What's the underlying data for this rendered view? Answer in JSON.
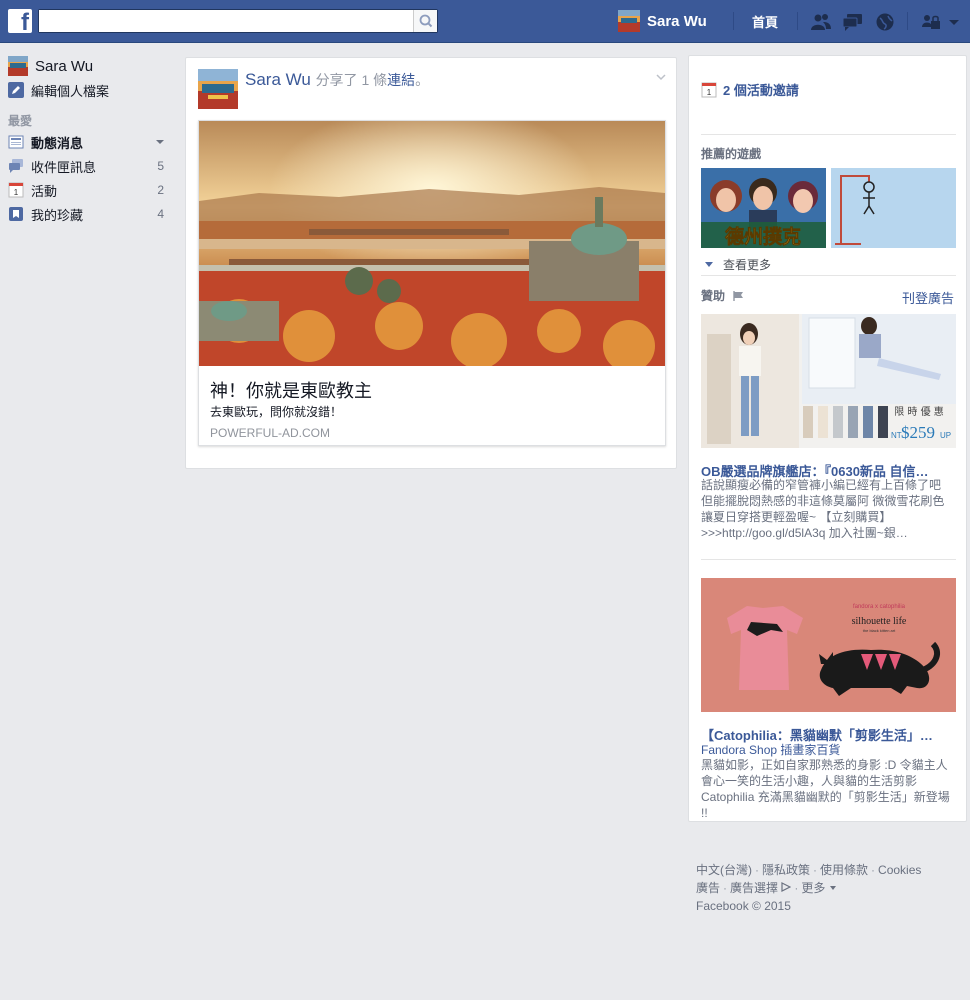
{
  "colors": {
    "brand": "#3b5998",
    "link": "#3b5998",
    "muted": "#9197a3"
  },
  "topbar": {
    "logo": "f",
    "search": {
      "value": "",
      "placeholder": "",
      "icon": "search-icon"
    },
    "profile_name": "Sara Wu",
    "home_label": "首頁",
    "icons": [
      "friend-requests-icon",
      "messages-icon",
      "notifications-globe-icon",
      "privacy-shortcuts-icon",
      "account-menu-chevron-icon"
    ]
  },
  "leftnav": {
    "profile_name": "Sara Wu",
    "edit_profile": "編輯個人檔案",
    "favorites_heading": "最愛",
    "items": [
      {
        "label": "動態消息",
        "icon": "news-feed-icon",
        "count": "",
        "bold": true
      },
      {
        "label": "收件匣訊息",
        "icon": "messages-icon",
        "count": "5"
      },
      {
        "label": "活動",
        "icon": "calendar-icon",
        "count": "2"
      },
      {
        "label": "我的珍藏",
        "icon": "saved-bookmark-icon",
        "count": "4"
      }
    ]
  },
  "post": {
    "author": "Sara Wu",
    "action_prefix": "分享了 1 條",
    "action_link": "連結",
    "action_suffix": "。",
    "card": {
      "title": "神！你就是東歐教主",
      "description": "去東歐玩，問你就沒錯！",
      "domain": "POWERFUL-AD.COM"
    }
  },
  "rightcol": {
    "events": "2 個活動邀請",
    "games_heading": "推薦的遊戲",
    "games": [
      {
        "title": "德州撲克"
      },
      {
        "title": ""
      }
    ],
    "see_more": "查看更多",
    "sponsored_heading": "贊助",
    "create_ad": "刊登廣告",
    "ads": [
      {
        "image_text_1": "限 時 優 惠",
        "image_price_prefix": "NT",
        "image_price": "$259",
        "image_price_suffix": "UP",
        "title": "OB嚴選品牌旗艦店：『0630新品 自信…",
        "body": "話說顯瘦必備的窄管褲小編已經有上百條了吧 但能擺脫悶熱感的非這條莫屬阿 微微雪花刷色讓夏日穿搭更輕盈喔~ 【立刻購買】>>>http://goo.gl/d5lA3q 加入社團~銀…"
      },
      {
        "image_brand": "fandora x catophilia",
        "image_title": "silhouette life",
        "image_subtitle": "the black kitten art",
        "title": "【Catophilia：黑貓幽默「剪影生活」…",
        "subtitle": "Fandora Shop 插畫家百貨",
        "body": "黑貓如影，正如自家那熟悉的身影 :D 令貓主人會心一笑的生活小趣，人與貓的生活剪影 Catophilia 充滿黑貓幽默的「剪影生活」新登場 !!"
      }
    ]
  },
  "footer": {
    "line1": [
      "中文(台灣)",
      "隱私政策",
      "使用條款",
      "Cookies"
    ],
    "line2": [
      "廣告",
      "廣告選擇",
      "更多"
    ],
    "copyright": "Facebook © 2015"
  }
}
